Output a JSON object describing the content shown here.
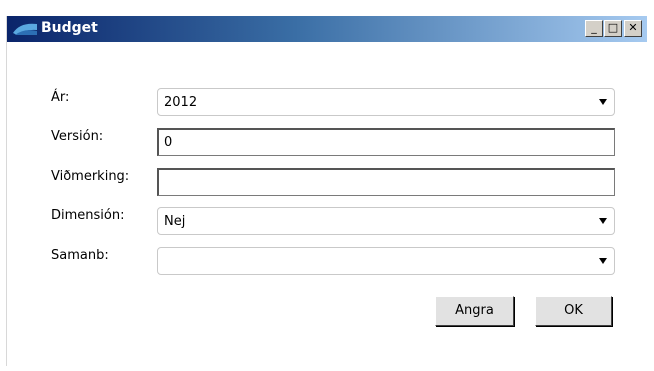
{
  "window": {
    "title": "Budget",
    "controls": {
      "minimize": "_",
      "maximize": "□",
      "close": "✕"
    }
  },
  "form": {
    "year": {
      "label": "Ár:",
      "value": "2012"
    },
    "version": {
      "label": "Versión:",
      "value": "0"
    },
    "note": {
      "label": "Viðmerking:",
      "value": ""
    },
    "dimension": {
      "label": "Dimensión:",
      "value": "Nej"
    },
    "compare": {
      "label": "Samanb:",
      "value": ""
    }
  },
  "buttons": {
    "cancel": "Angra",
    "ok": "OK"
  }
}
